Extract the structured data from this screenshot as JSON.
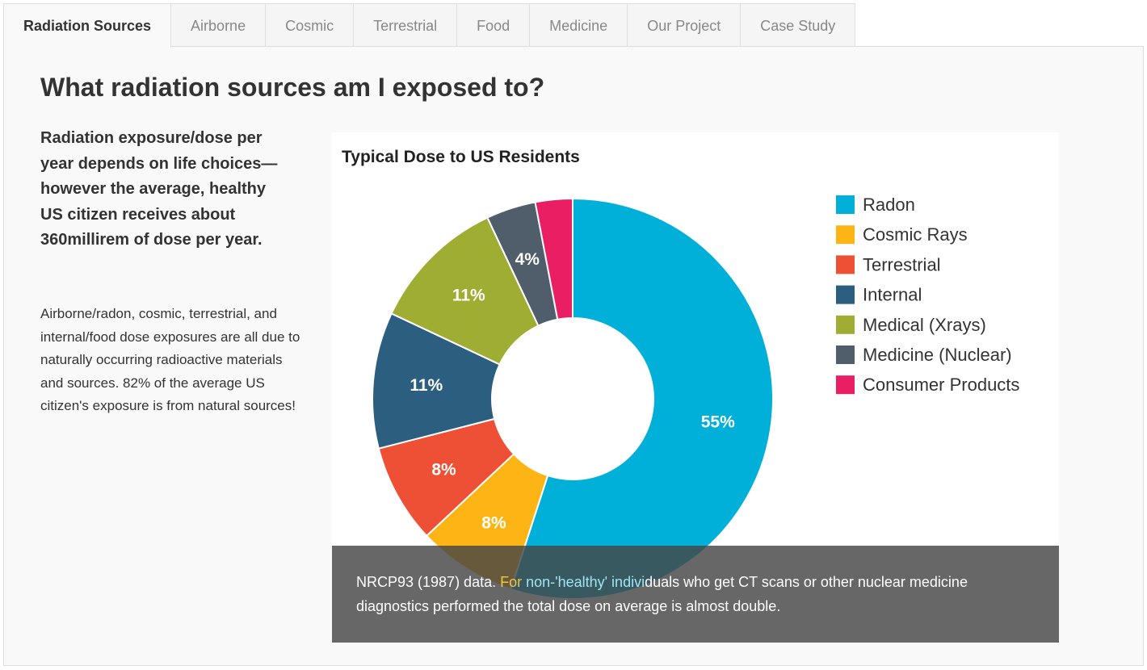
{
  "tabs": [
    {
      "label": "Radiation Sources",
      "active": true
    },
    {
      "label": "Airborne",
      "active": false
    },
    {
      "label": "Cosmic",
      "active": false
    },
    {
      "label": "Terrestrial",
      "active": false
    },
    {
      "label": "Food",
      "active": false
    },
    {
      "label": "Medicine",
      "active": false
    },
    {
      "label": "Our Project",
      "active": false
    },
    {
      "label": "Case Study",
      "active": false
    }
  ],
  "main": {
    "title": "What radiation sources am I exposed to?",
    "lead": "Radiation exposure/dose per year depends on life choices—however the average, healthy US citizen receives about 360millirem of dose per year.",
    "body": "Airborne/radon, cosmic, terrestrial, and internal/food dose exposures are all due to naturally occurring radioactive materials and sources. 82% of the average US citizen's exposure is from natural sources!"
  },
  "caption": {
    "part1": "NRCP93 (1987) data. ",
    "part2": "For ",
    "part3": "non-'healthy' indivi",
    "part4": "duals who get CT scans or other nuclear medicine diagnostics performed the total dose on average is almost double."
  },
  "chart_data": {
    "type": "pie",
    "title": "Typical Dose to US Residents",
    "donut": true,
    "legend_position": "right",
    "slices": [
      {
        "label": "Radon",
        "value": 55,
        "display": "55%",
        "color": "#00b0d8"
      },
      {
        "label": "Cosmic Rays",
        "value": 8,
        "display": "8%",
        "color": "#fdb515"
      },
      {
        "label": "Terrestrial",
        "value": 8,
        "display": "8%",
        "color": "#ed5035"
      },
      {
        "label": "Internal",
        "value": 11,
        "display": "11%",
        "color": "#2c5f7f"
      },
      {
        "label": "Medical (Xrays)",
        "value": 11,
        "display": "11%",
        "color": "#a0ad33"
      },
      {
        "label": "Medicine (Nuclear)",
        "value": 4,
        "display": "4%",
        "color": "#505e6c"
      },
      {
        "label": "Consumer Products",
        "value": 3,
        "display": "",
        "color": "#e91e63"
      }
    ]
  }
}
